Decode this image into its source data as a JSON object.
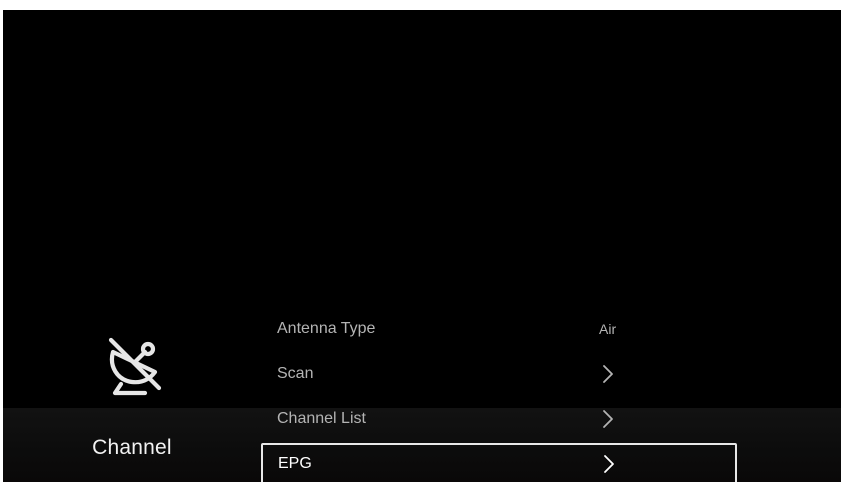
{
  "category": {
    "label": "Channel",
    "icon": "satellite-dish-off-icon"
  },
  "menu": {
    "items": [
      {
        "label": "Antenna Type",
        "value": "Air",
        "kind": "value"
      },
      {
        "label": "Scan",
        "value": null,
        "kind": "submenu",
        "icon": "chevron-right-icon"
      },
      {
        "label": "Channel List",
        "value": null,
        "kind": "submenu",
        "icon": "chevron-right-icon"
      },
      {
        "label": "EPG",
        "value": null,
        "kind": "submenu",
        "icon": "chevron-right-icon",
        "focused": true
      }
    ]
  },
  "colors": {
    "background": "#000000",
    "text_dim": "#b4b4b4",
    "text_focus": "#ffffff",
    "focus_border": "#e8e8e8"
  }
}
